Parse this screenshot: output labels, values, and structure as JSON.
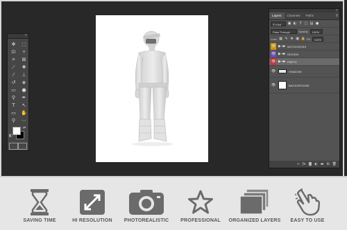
{
  "toolbox": {
    "grip_label": "«",
    "tools": [
      {
        "name": "move-tool-icon",
        "glyph": "✥"
      },
      {
        "name": "marquee-tool-icon",
        "glyph": "⬚"
      },
      {
        "name": "lasso-tool-icon",
        "glyph": "ᘏ"
      },
      {
        "name": "magic-wand-tool-icon",
        "glyph": "✧"
      },
      {
        "name": "crop-tool-icon",
        "glyph": "⌗"
      },
      {
        "name": "slice-tool-icon",
        "glyph": "⊠"
      },
      {
        "name": "eyedropper-tool-icon",
        "glyph": "⟋"
      },
      {
        "name": "healing-brush-tool-icon",
        "glyph": "✚"
      },
      {
        "name": "brush-tool-icon",
        "glyph": "⁄"
      },
      {
        "name": "stamp-tool-icon",
        "glyph": "⊥"
      },
      {
        "name": "history-brush-tool-icon",
        "glyph": "↺"
      },
      {
        "name": "eraser-tool-icon",
        "glyph": "◈"
      },
      {
        "name": "gradient-tool-icon",
        "glyph": "▭"
      },
      {
        "name": "blur-tool-icon",
        "glyph": "●"
      },
      {
        "name": "dodge-tool-icon",
        "glyph": "⚲"
      },
      {
        "name": "pen-tool-icon",
        "glyph": "✒"
      },
      {
        "name": "type-tool-icon",
        "glyph": "T"
      },
      {
        "name": "path-selection-tool-icon",
        "glyph": "↖"
      },
      {
        "name": "shape-tool-icon",
        "glyph": "▭"
      },
      {
        "name": "hand-tool-icon",
        "glyph": "✋"
      },
      {
        "name": "zoom-tool-icon",
        "glyph": "⚲"
      },
      {
        "name": "more-tools-icon",
        "glyph": "⋯"
      }
    ],
    "colors": {
      "foreground": "#ffffff",
      "background": "#000000"
    }
  },
  "layers_panel": {
    "grip_label": "«",
    "tabs": [
      "Layers",
      "Channels",
      "Paths"
    ],
    "menu_glyph": "≡",
    "filter_label": "Kind",
    "blend_mode": "Pass Through",
    "opacity_label": "Opacity:",
    "opacity_value": "100%",
    "lock_label": "Lock:",
    "fill_label": "Fill:",
    "fill_value": "100%",
    "layers": [
      {
        "name": "MOTOCROSS",
        "type": "group",
        "eye_color": "#c8960c",
        "selected": false
      },
      {
        "name": "DESIGN",
        "type": "group",
        "eye_color": "#6a4fa8",
        "selected": false
      },
      {
        "name": "PARTS",
        "type": "group",
        "eye_color": "#c0393b",
        "selected": true
      },
      {
        "name": "SHADOW",
        "type": "layer",
        "eye_color": "",
        "selected": false
      },
      {
        "name": "BACKGROUND",
        "type": "layer",
        "eye_color": "",
        "selected": false
      }
    ]
  },
  "features": [
    {
      "name": "hourglass-icon",
      "label": "SAVING TIME"
    },
    {
      "name": "expand-arrows-icon",
      "label": "HI RESOLUTION"
    },
    {
      "name": "camera-icon",
      "label": "PHOTOREALISTIC"
    },
    {
      "name": "star-icon",
      "label": "PROFESSIONAL"
    },
    {
      "name": "stacked-layers-icon",
      "label": "ORGANIZED LAYERS"
    },
    {
      "name": "pointing-hand-icon",
      "label": "EASY TO USE"
    }
  ]
}
